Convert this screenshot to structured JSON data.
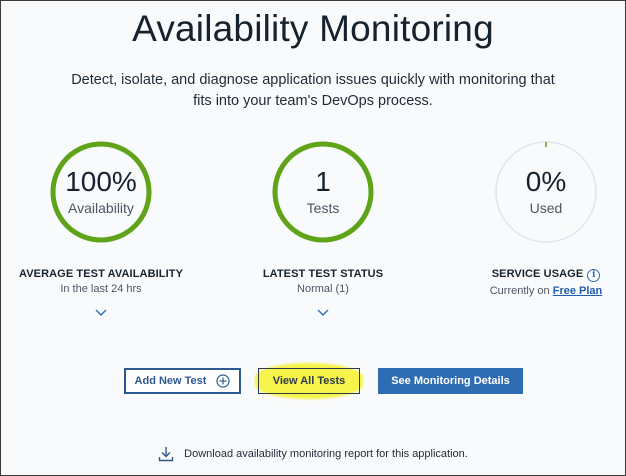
{
  "header": {
    "title": "Availability Monitoring",
    "subtitle": "Detect, isolate, and diagnose application issues quickly with monitoring that fits into your team's DevOps process."
  },
  "metrics": [
    {
      "value": "100%",
      "sub": "Availability",
      "label": "AVERAGE TEST AVAILABILITY",
      "detail": "In the last 24 hrs",
      "fill": 1.0,
      "color": "#5fa319"
    },
    {
      "value": "1",
      "sub": "Tests",
      "label": "LATEST TEST STATUS",
      "detail": "Normal (1)",
      "fill": 1.0,
      "color": "#5fa319"
    },
    {
      "value": "0%",
      "sub": "Used",
      "label": "SERVICE USAGE",
      "detail_prefix": "Currently on",
      "detail_link": "Free Plan",
      "fill": 0.0,
      "color": "#5fa319"
    }
  ],
  "icons": {
    "chevron": "chevron-down-icon",
    "info": "info-icon",
    "add": "plus-circle-icon",
    "download": "download-icon"
  },
  "buttons": {
    "add_new_test": "Add New Test",
    "view_all_tests": "View All Tests",
    "see_monitoring_details": "See Monitoring Details"
  },
  "footer": {
    "download_text": "Download availability monitoring report for this application."
  },
  "colors": {
    "ring_active": "#5fa319",
    "ring_track": "#e2e5e8",
    "primary": "#2f6db3",
    "highlight": "#f6f34a"
  }
}
